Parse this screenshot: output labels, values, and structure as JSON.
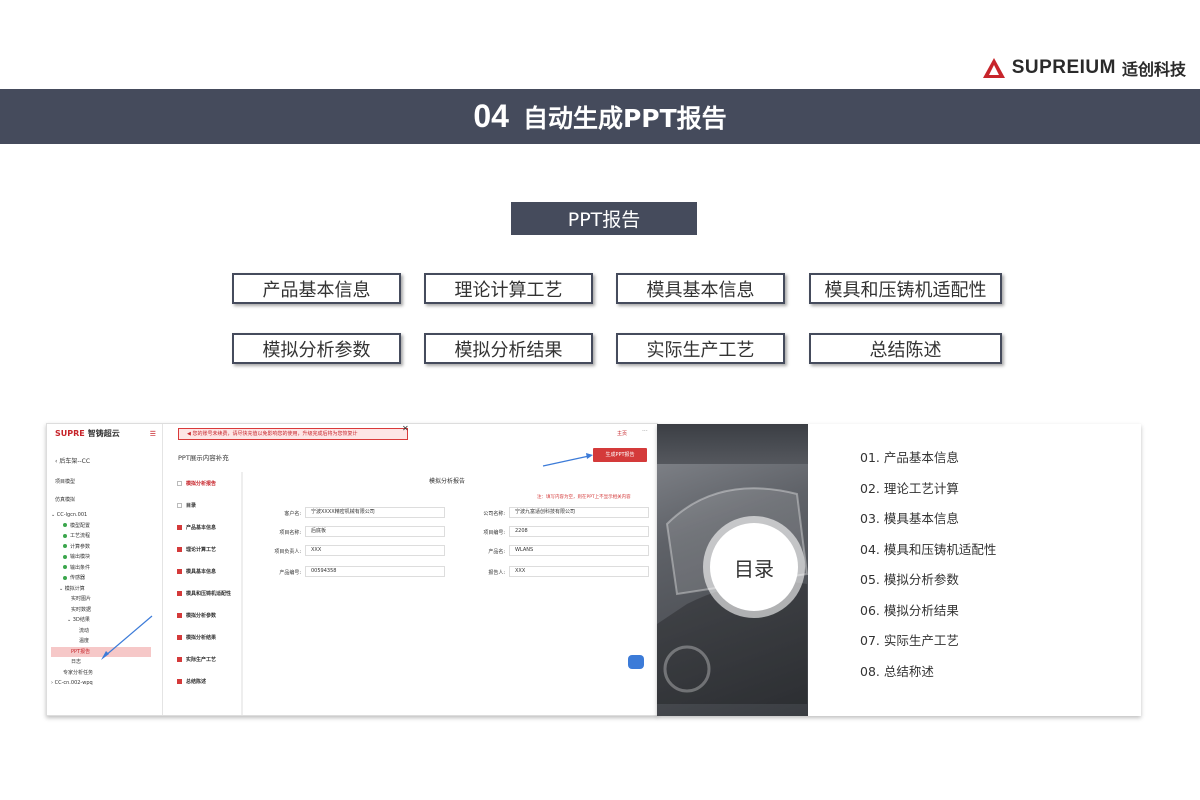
{
  "brand": {
    "name": "SUPREIUM",
    "name_cn": "适创科技"
  },
  "header": {
    "number": "04",
    "title": "自动生成PPT报告"
  },
  "ppt_label": "PPT报告",
  "sections": [
    "产品基本信息",
    "理论计算工艺",
    "模具基本信息",
    "模具和压铸机适配性",
    "模拟分析参数",
    "模拟分析结果",
    "实际生产工艺",
    "总结陈述"
  ],
  "screenshot": {
    "app_name": "智铸超云",
    "logo_text": "SUPRE",
    "back_label": "后车架--CC",
    "project_model": "项目模型",
    "sim_model": "仿真模拟",
    "tree": [
      "CC-lgcn.001",
      "模型配置",
      "工艺流程",
      "计算参数",
      "输出模块",
      "输出条件",
      "传感器",
      "模拟计算",
      "实时图片",
      "实时数据",
      "3D结果",
      "流动",
      "温度",
      "PPT报告",
      "日志",
      "专家分析任务",
      "CC-cn.002-wpq"
    ],
    "notice": "您的账号未续费，请尽快充值以免影响您的使用，升级完成后将为您恢复计",
    "home_tab": "主页",
    "panel_title": "PPT展示内容补充",
    "generate_button": "生成PPT报告",
    "nav": [
      "模拟分析报告",
      "目录",
      "产品基本信息",
      "理论计算工艺",
      "模具基本信息",
      "模具和压铸机适配性",
      "模拟分析参数",
      "模拟分析结果",
      "实际生产工艺",
      "总结陈述"
    ],
    "form_title": "模拟分析报告",
    "form_note": "注：填写内容为空，则在PPT上不显示相关内容",
    "fields": [
      {
        "label": "客户名:",
        "value": "宁波XXXX精密机械有限公司"
      },
      {
        "label": "公司名称:",
        "value": "宁波九富适创科技有限公司"
      },
      {
        "label": "项目名称:",
        "value": "后底板"
      },
      {
        "label": "项目编号:",
        "value": "2208"
      },
      {
        "label": "项目负责人:",
        "value": "XXX"
      },
      {
        "label": "产品名:",
        "value": "WLANS"
      },
      {
        "label": "产品编号:",
        "value": "00594358"
      },
      {
        "label": "报告人:",
        "value": "XXX"
      }
    ]
  },
  "toc": {
    "title": "目录",
    "items": [
      "01. 产品基本信息",
      "02. 理论工艺计算",
      "03. 模具基本信息",
      "04. 模具和压铸机适配性",
      "05. 模拟分析参数",
      "06. 模拟分析结果",
      "07. 实际生产工艺",
      "08. 总结称述"
    ]
  },
  "colors": {
    "band": "#454b5c",
    "accent": "#c7252b"
  }
}
